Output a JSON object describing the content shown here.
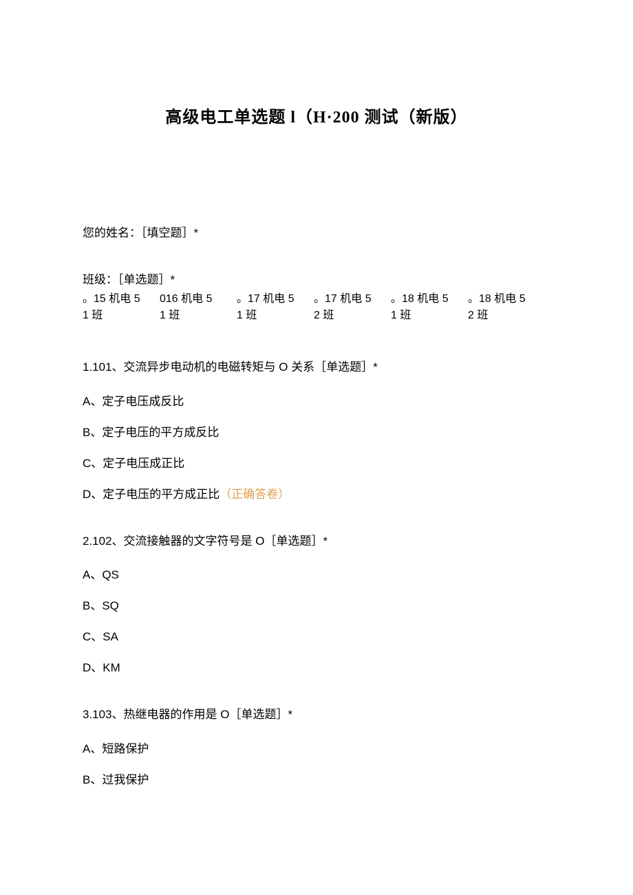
{
  "title": "高级电工单选题 l（H·200 测试（新版）",
  "name_field": "您的姓名：［填空题］*",
  "class_label": "班级：［单选题］*",
  "class_options": [
    {
      "line1": "。15 机电 5",
      "line2": "1 班"
    },
    {
      "line1": "016 机电 5",
      "line2": "1 班"
    },
    {
      "line1": "。17 机电 5",
      "line2": "1 班"
    },
    {
      "line1": "。17 机电 5",
      "line2": "2 班"
    },
    {
      "line1": "。18 机电 5",
      "line2": "1 班"
    },
    {
      "line1": "。18 机电 5",
      "line2": "2 班"
    }
  ],
  "questions": [
    {
      "text": "1.101、交流异步电动机的电磁转矩与 O 关系［单选题］*",
      "options": [
        {
          "label": "A、定子电压成反比",
          "correct": false
        },
        {
          "label": "B、定子电压的平方成反比",
          "correct": false
        },
        {
          "label": "C、定子电压成正比",
          "correct": false
        },
        {
          "label": "D、定子电压的平方成正比",
          "correct": true
        }
      ]
    },
    {
      "text": "2.102、交流接触器的文字符号是 O［单选题］*",
      "options": [
        {
          "label": "A、QS",
          "correct": false
        },
        {
          "label": "B、SQ",
          "correct": false
        },
        {
          "label": "C、SA",
          "correct": false
        },
        {
          "label": "D、KM",
          "correct": false
        }
      ]
    },
    {
      "text": "3.103、热继电器的作用是 O［单选题］*",
      "options": [
        {
          "label": "A、短路保护",
          "correct": false
        },
        {
          "label": "B、过我保护",
          "correct": false
        }
      ]
    }
  ],
  "correct_suffix": "（正确答卷）"
}
